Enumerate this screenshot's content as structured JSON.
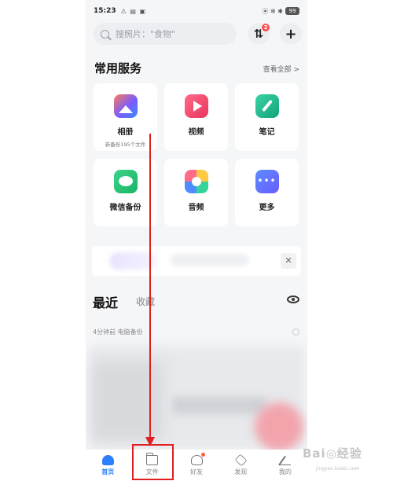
{
  "status_bar": {
    "time": "15:23",
    "left_indicators": "⚠ ▤ ▣",
    "right_indicators": "⦿ ✻ ✱",
    "battery": "99"
  },
  "header": {
    "search_placeholder": "搜照片：\"食物\"",
    "transfer_badge": "2"
  },
  "services": {
    "title": "常用服务",
    "view_all": "查看全部 >",
    "items": [
      {
        "label": "相册",
        "sub": "新备份195个文件",
        "icon": "album-icon"
      },
      {
        "label": "视频",
        "sub": "",
        "icon": "video-icon"
      },
      {
        "label": "笔记",
        "sub": "",
        "icon": "notes-icon"
      },
      {
        "label": "微信备份",
        "sub": "",
        "icon": "wechat-backup-icon"
      },
      {
        "label": "音频",
        "sub": "",
        "icon": "audio-icon"
      },
      {
        "label": "更多",
        "sub": "",
        "icon": "more-icon"
      }
    ]
  },
  "banner": {
    "close_glyph": "✕"
  },
  "recent": {
    "title": "最近",
    "favorites_tab": "收藏",
    "meta": "4分钟前  电脑备份"
  },
  "tabbar": {
    "items": [
      {
        "label": "首页",
        "active": true
      },
      {
        "label": "文件",
        "active": false
      },
      {
        "label": "好友",
        "active": false
      },
      {
        "label": "发现",
        "active": false
      },
      {
        "label": "我的",
        "active": false
      }
    ]
  },
  "overlay": {
    "annotation_color": "#e02020",
    "watermark": "Bai◎经验",
    "watermark_sub": "jingyan.baidu.com"
  },
  "colors": {
    "accent": "#2b7fff",
    "page_bg": "#f5f6f8",
    "badge": "#ff4d4f"
  }
}
